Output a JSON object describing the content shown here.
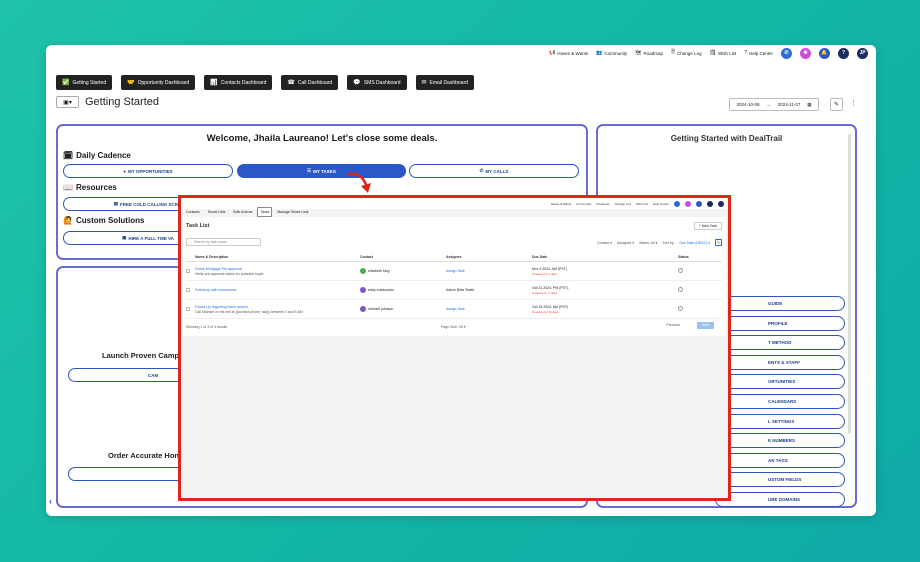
{
  "topbar": {
    "links": [
      {
        "icon": "megaphone-icon",
        "glyph": "📢",
        "label": "Haves & Wants"
      },
      {
        "icon": "community-icon",
        "glyph": "👥",
        "label": "Community"
      },
      {
        "icon": "roadmap-icon",
        "glyph": "🗺",
        "label": "Roadmap"
      },
      {
        "icon": "changelog-icon",
        "glyph": "🗎",
        "label": "Change Log"
      },
      {
        "icon": "wishlist-icon",
        "glyph": "🗒",
        "label": "Wish List"
      },
      {
        "icon": "help-icon",
        "glyph": "?",
        "label": "Help Center"
      }
    ],
    "circles": [
      {
        "name": "phone-icon",
        "glyph": "✆",
        "color": "#2b6cd4"
      },
      {
        "name": "app-icon",
        "glyph": "❋",
        "color": "#c94fd6"
      },
      {
        "name": "bell-icon",
        "glyph": "🔔",
        "color": "#2b58c6"
      },
      {
        "name": "help-circle-icon",
        "glyph": "?",
        "color": "#1c2b5e"
      },
      {
        "name": "avatar",
        "glyph": "JP",
        "color": "#1c2b5e"
      }
    ]
  },
  "nav": {
    "buttons": [
      {
        "icon": "check-icon",
        "glyph": "✅",
        "label": "Getting Started"
      },
      {
        "icon": "handshake-icon",
        "glyph": "🤝",
        "label": "Opportunity Dashboard"
      },
      {
        "icon": "chart-icon",
        "glyph": "📊",
        "label": "Contacts Dashboard"
      },
      {
        "icon": "phone-call-icon",
        "glyph": "☎",
        "label": "Call Dashboard"
      },
      {
        "icon": "sms-icon",
        "glyph": "💬",
        "label": "SMS Dashboard"
      },
      {
        "icon": "email-icon",
        "glyph": "✉",
        "label": "Email Dashboard"
      }
    ]
  },
  "page": {
    "title": "Getting Started",
    "date_start": "2024-10-08",
    "date_end": "2024-11-07",
    "layout_glyph": "▣▾",
    "arrow_glyph": "→",
    "calendar_glyph": "▦",
    "pencil_glyph": "✎",
    "kebab_glyph": "⋮",
    "back_glyph": "‹"
  },
  "welcome": {
    "heading": "Welcome, Jhaila Laureano! Let's close some deals.",
    "daily_cadence": "Daily Cadence",
    "daily_icon": "🗓",
    "btn_opportunities": "MY OPPORTUNITIES",
    "btn_tasks": "MY TASKS",
    "btn_calls": "MY CALLS",
    "resources": "Resources",
    "resources_icon": "📖",
    "btn_cold_calling": "FREE COLD CALLING SCRIP",
    "custom_solutions": "Custom Solutions",
    "custom_icon": "🙋",
    "btn_hire": "HIRE A FULL TME VA"
  },
  "left2": {
    "launch": "Launch Proven Camp",
    "cam": "CAM",
    "order": "Order Accurate Hon"
  },
  "dealtrail": {
    "title": "Getting Started with DealTrail",
    "items": [
      "GUIDE",
      "PROFILE",
      "T METHOD",
      "ENTS & STAFF",
      "ORTUNITIES",
      "CALENDARS",
      "L SETTINGS",
      "E NUMBERS",
      "AN TAGS",
      "USTOM FIELDS",
      "URE DOMAINS"
    ]
  },
  "overlay": {
    "tabs": [
      "Contacts",
      "Smart Lists",
      "Bulk Actions",
      "Tasks",
      "Manage Smart Lists"
    ],
    "selected_tab": "Tasks",
    "title": "Task List",
    "new_task": "+ New Task",
    "search_placeholder": "Search by task name",
    "filters": {
      "contact": "Contact ▾",
      "assignee": "Assignee ▾",
      "status": "Status: All ▾",
      "sort_label": "Sort by:",
      "sort_value": "Due Date (DESC) ▾"
    },
    "columns": [
      "Name & Description",
      "Contact",
      "Assignee",
      "Due Date",
      "Status"
    ],
    "rows": [
      {
        "name": "Check Mortgage Pre-approval",
        "desc": "Verify pre-approval status for potential buyer",
        "contact": "elizabeth king",
        "avatar_color": "#4caf50",
        "assignee": "Assign Task",
        "due": "Nov 4 2024,",
        "due_time": "AM (PST)",
        "due_note": "Overdue by 3 days"
      },
      {
        "name": "Follow-up with homeowner",
        "desc": "",
        "contact": "eddy maldonado",
        "avatar_color": "#7e57c2",
        "assignee": "Admin Beta Tester",
        "due": "Oct 31 2024,",
        "due_time": "PM (PST)",
        "due_note": "Overdue by 7 days"
      },
      {
        "name": "Follow-Up regarding home search",
        "desc": "Call Michael on his cell at {{contact.phone_raw}} between 4 and 5 AM",
        "contact": "michael johnson",
        "avatar_color": "#7e57c2",
        "assignee": "Assign Task",
        "due": "Oct 25 2024,",
        "due_time": "AM (PST)",
        "due_note": "Overdue by 13 days"
      }
    ],
    "showing": "Showing 1 to 3 of 3 results",
    "page_size": "Page Size: 25 ▾",
    "previous": "Previous",
    "next": "Next"
  },
  "colors": {
    "accent": "#2b58c6",
    "highlight": "#e0261c",
    "card_border": "#6b6bd6"
  }
}
